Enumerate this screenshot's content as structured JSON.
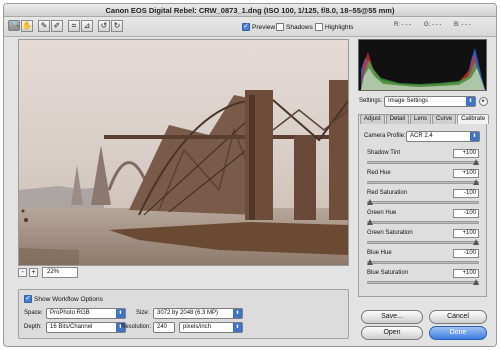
{
  "window": {
    "title": "Canon EOS Digital Rebel:  CRW_0873_1.dng  (ISO 100, 1/125, f/8.0, 18–55@55 mm)"
  },
  "toolbar": {
    "tools": [
      {
        "icon": "zoom-icon",
        "glyph": "🔍"
      },
      {
        "icon": "hand-icon",
        "glyph": "✋"
      },
      {
        "icon": "eyedropper-icon",
        "glyph": "✎"
      },
      {
        "icon": "color-sampler-icon",
        "glyph": "✐"
      },
      {
        "icon": "crop-icon",
        "glyph": "⌗"
      },
      {
        "icon": "straighten-icon",
        "glyph": "⊿"
      },
      {
        "icon": "rotate-left-icon",
        "glyph": "↺"
      },
      {
        "icon": "rotate-right-icon",
        "glyph": "↻"
      }
    ],
    "preview_label": "Preview",
    "shadows_label": "Shadows",
    "highlights_label": "Highlights",
    "readout": {
      "r": "R: - - -",
      "g": "G: - - -",
      "b": "B: - - -"
    }
  },
  "zoom": {
    "minus": "-",
    "plus": "+",
    "value": "22%"
  },
  "settings": {
    "label": "Settings:",
    "value": "Image Settings"
  },
  "tabs": [
    "Adjust",
    "Detail",
    "Lens",
    "Curve",
    "Calibrate"
  ],
  "active_tab": "Calibrate",
  "calibrate": {
    "camera_profile_label": "Camera Profile:",
    "camera_profile_value": "ACR 2.4",
    "sliders": [
      {
        "label": "Shadow Tint",
        "value": "+100",
        "level": 1.0
      },
      {
        "label": "Red Hue",
        "value": "+100",
        "level": 1.0
      },
      {
        "label": "Red Saturation",
        "value": "-100",
        "level": 0.0
      },
      {
        "label": "Green Hue",
        "value": "-100",
        "level": 0.0
      },
      {
        "label": "Green Saturation",
        "value": "+100",
        "level": 1.0
      },
      {
        "label": "Blue Hue",
        "value": "-100",
        "level": 0.0
      },
      {
        "label": "Blue Saturation",
        "value": "+100",
        "level": 1.0
      }
    ]
  },
  "workflow": {
    "show_label": "Show Workflow Options",
    "space_label": "Space:",
    "space_value": "ProPhoto RGB",
    "size_label": "Size:",
    "size_value": "3072 by 2048 (6.3 MP)",
    "depth_label": "Depth:",
    "depth_value": "16 Bits/Channel",
    "resolution_label": "Resolution:",
    "resolution_value": "240",
    "resolution_unit": "pixels/inch"
  },
  "buttons": {
    "save": "Save...",
    "cancel": "Cancel",
    "open": "Open",
    "done": "Done"
  },
  "colors": {
    "accent": "#3f73c8",
    "histogram_bg": "#111111"
  }
}
